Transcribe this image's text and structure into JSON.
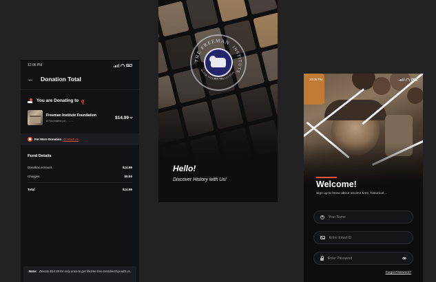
{
  "colors": {
    "background": "#222222",
    "screen": "#111214",
    "accent": "#e8553a",
    "text": "#ffffff"
  },
  "donation_screen": {
    "status_time": "12:05 PM",
    "title": "Donation Total",
    "donating_label": "You are Donating to",
    "org": {
      "name": "Freeman Institute Foundation",
      "subtitle": "A Foundation of... ... ...",
      "amount": "$14.99"
    },
    "more_donation": {
      "text": "For More Donation",
      "link": "Contact Us"
    },
    "fund_details": {
      "title": "Fund Details",
      "rows": [
        {
          "label": "Donation Amount",
          "value": "$14.99"
        },
        {
          "label": "Charges",
          "value": "$0.00"
        }
      ],
      "total": {
        "label": "Total",
        "value": "$14.99"
      }
    },
    "note": {
      "label": "Note:",
      "text": "Donate $14.99 for only once to get lifetime free membership with us."
    }
  },
  "splash_screen": {
    "seal_top_text": "THE FREEMAN",
    "seal_side_text": "INSTITUTE",
    "seal_bottom_text": "BLACK HISTORY COLLECTION",
    "seal_year": "EST. 1990",
    "greeting": "Hello!",
    "tagline": "Discover History with Us!"
  },
  "welcome_screen": {
    "status_time": "10:05 PM",
    "title": "Welcome!",
    "subtitle": "Sign up to know about ancient time, historical...",
    "name_placeholder": "Your Name",
    "email_placeholder": "Enter Email ID",
    "password_placeholder": "Enter Password",
    "forgot_password": "Forgot Password?"
  }
}
